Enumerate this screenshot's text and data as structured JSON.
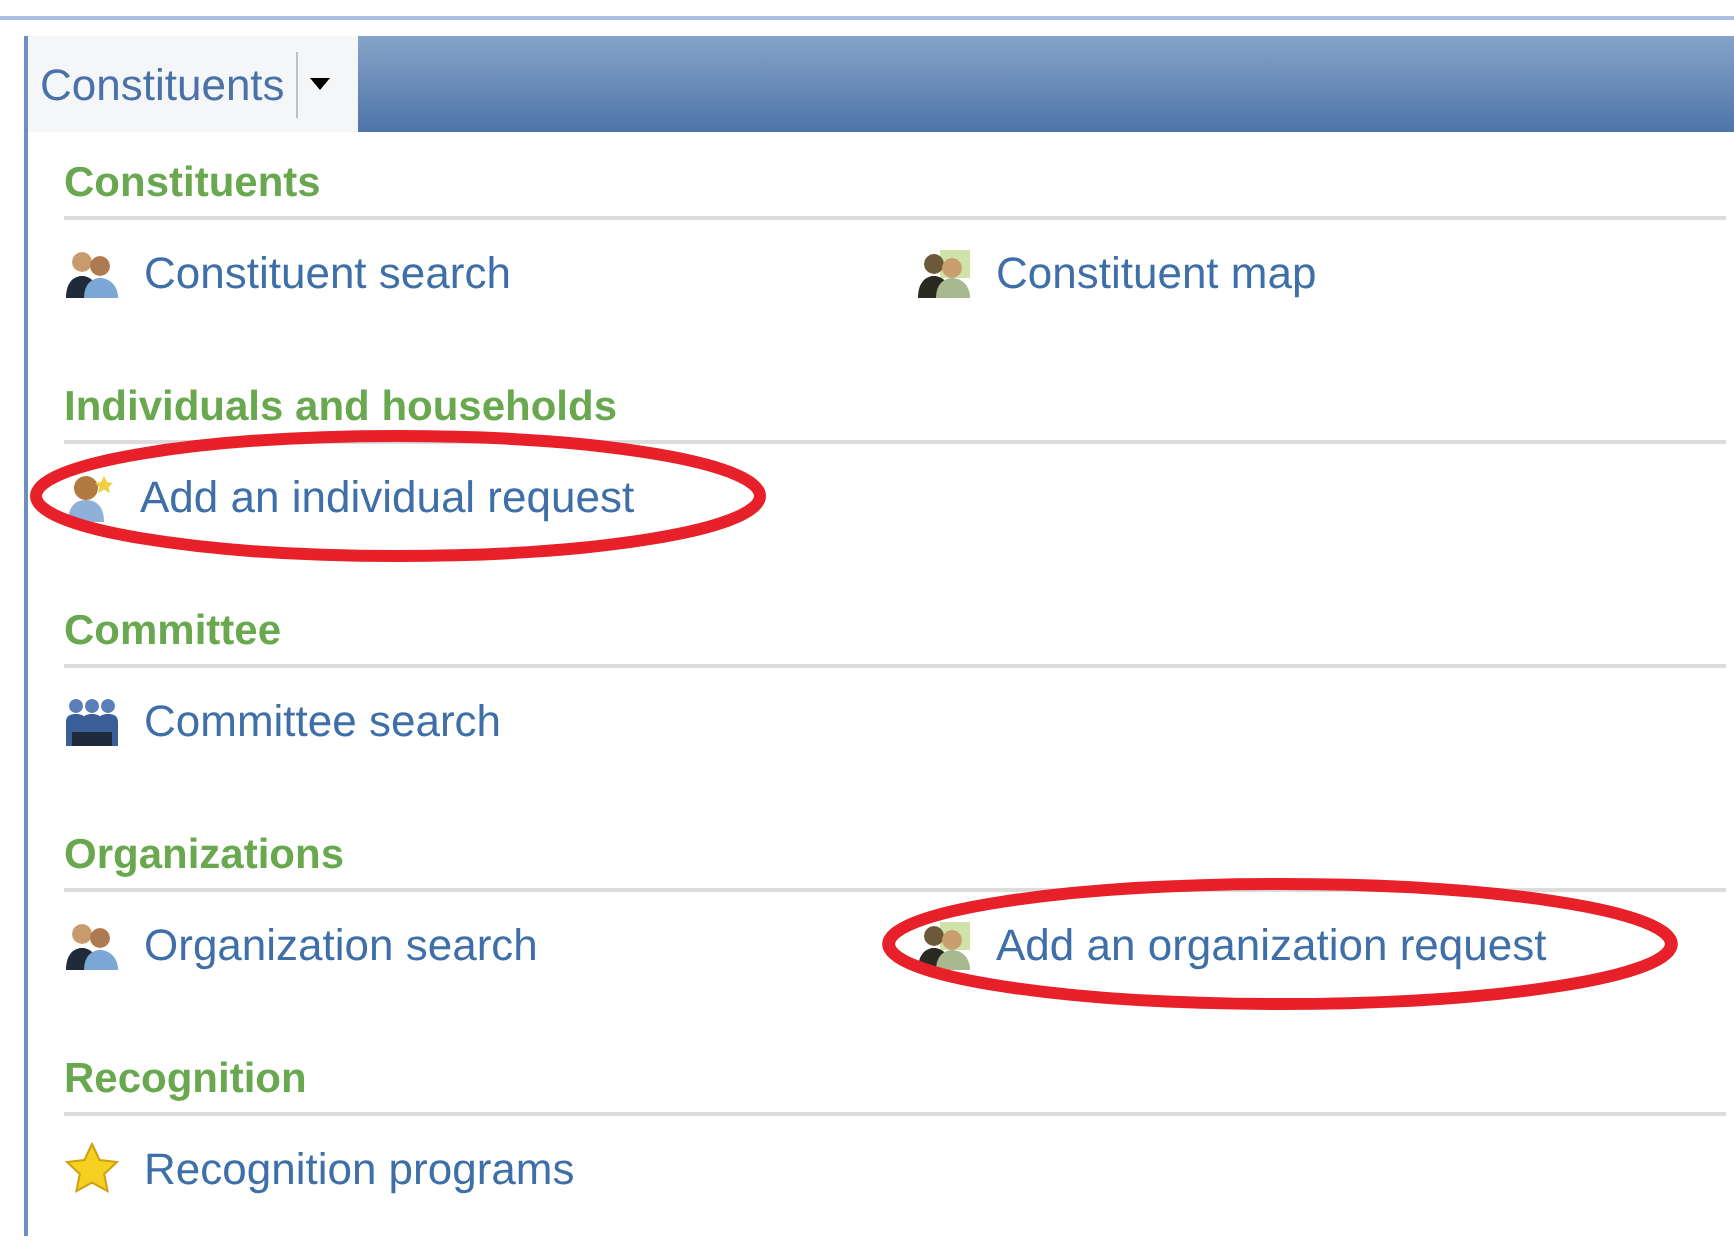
{
  "tab": {
    "label": "Constituents",
    "selected": true
  },
  "sections": [
    {
      "title": "Constituents",
      "items": [
        {
          "kind": "pair",
          "label": "Constituent search",
          "circled": false
        },
        {
          "kind": "map",
          "label": "Constituent map",
          "circled": false
        }
      ]
    },
    {
      "title": "Individuals and households",
      "items": [
        {
          "kind": "person",
          "label": "Add an individual request",
          "circled": true
        }
      ]
    },
    {
      "title": "Committee",
      "items": [
        {
          "kind": "group",
          "label": "Committee search",
          "circled": false
        }
      ]
    },
    {
      "title": "Organizations",
      "items": [
        {
          "kind": "pair",
          "label": "Organization search",
          "circled": false
        },
        {
          "kind": "map",
          "label": "Add an organization request",
          "circled": true
        }
      ]
    },
    {
      "title": "Recognition",
      "items": [
        {
          "kind": "star",
          "label": "Recognition programs",
          "circled": false
        }
      ]
    }
  ]
}
